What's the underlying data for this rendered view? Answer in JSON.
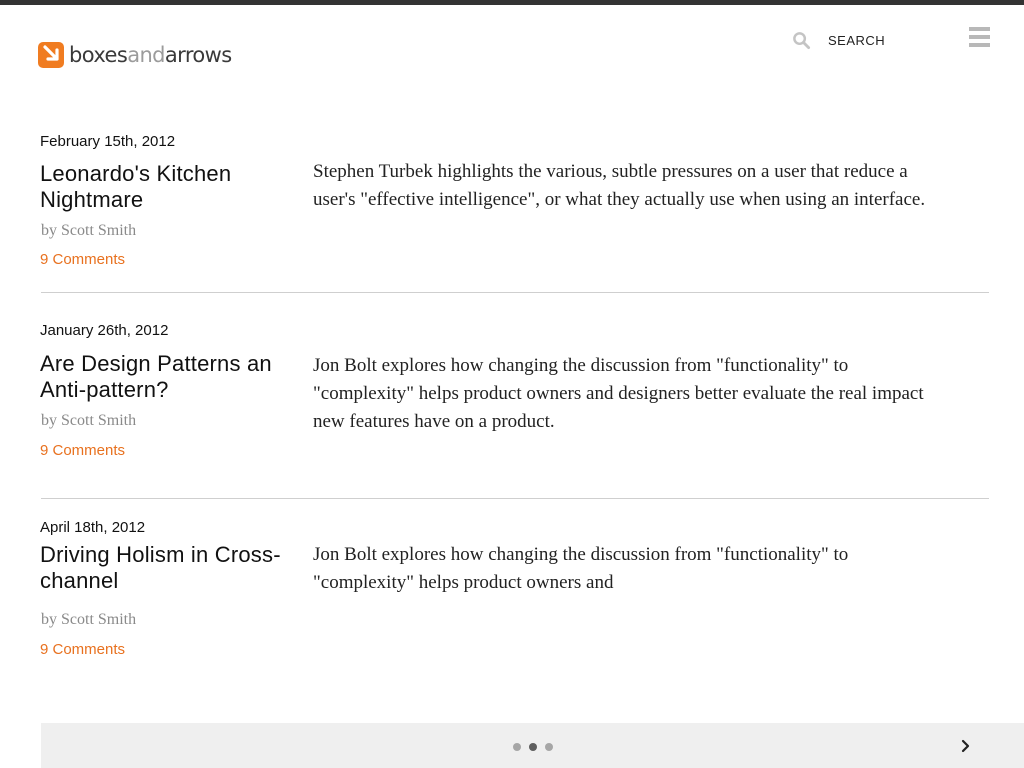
{
  "header": {
    "logo": {
      "part1": "boxes",
      "part2": "and",
      "part3": "arrows"
    },
    "search_label": "SEARCH"
  },
  "articles": [
    {
      "date": "February 15th, 2012",
      "title": "Leonardo's Kitchen Nightmare",
      "author": "by Scott Smith",
      "comments": "9 Comments",
      "summary": "Stephen Turbek highlights the various, subtle pressures on a user that reduce a user's \"effective intelligence\", or what they actually use when using an interface."
    },
    {
      "date": "January 26th, 2012",
      "title": "Are Design Patterns an Anti-pattern?",
      "author": "by Scott Smith",
      "comments": "9 Comments",
      "summary": "Jon Bolt explores how changing the discussion from \"functionality\" to \"complexity\" helps product owners and designers better evaluate the real impact new features have on a product."
    },
    {
      "date": "April 18th, 2012",
      "title": "Driving Holism in Cross-channel",
      "author": "by Scott Smith",
      "comments": "9 Comments",
      "summary": "Jon Bolt explores how changing the discussion from \"functionality\" to \"complexity\" helps product owners and"
    }
  ],
  "pagination": {
    "pages": 3,
    "current": 2
  },
  "colors": {
    "accent": "#e8711f",
    "logo_orange": "#f07c21",
    "top_bar": "#333333",
    "footer_bg": "#efefef"
  }
}
